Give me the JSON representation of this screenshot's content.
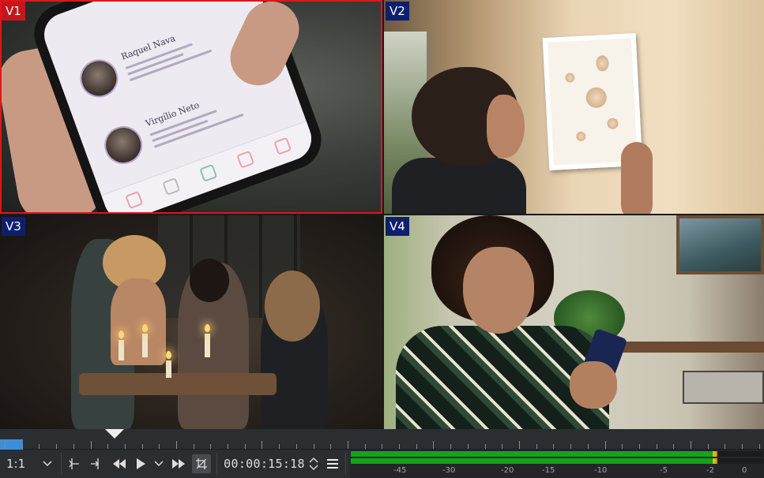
{
  "multicam": {
    "active_view": "V1",
    "views": [
      {
        "id": "v1",
        "label": "V1",
        "content": "Hand holding a phone showing profile app"
      },
      {
        "id": "v2",
        "label": "V2",
        "content": "Man hanging a shell frame on a wall"
      },
      {
        "id": "v3",
        "label": "V3",
        "content": "Candlelit dinner party"
      },
      {
        "id": "v4",
        "label": "V4",
        "content": "Woman looking at her phone"
      }
    ],
    "phone_screen": {
      "person1_name": "Raquel Nava",
      "person2_name": "Virgílio Neto"
    }
  },
  "timeline": {
    "progress_fraction": 0.03
  },
  "toolbar": {
    "zoom_label": "1:1",
    "timecode": "00:00:15:18",
    "icons": [
      "zoom-dropdown-icon",
      "set-zone-in-icon",
      "set-zone-out-icon",
      "rewind-icon",
      "play-icon",
      "play-options-icon",
      "forward-icon",
      "crop-icon",
      "spin-icon",
      "menu-icon"
    ]
  },
  "audio_meter": {
    "scale": [
      "-45",
      "-30",
      "-20",
      "-15",
      "-10",
      "-5",
      "-2",
      "0"
    ],
    "level_left_db": -2,
    "level_right_db": -2,
    "colors": {
      "green": "#14a31d",
      "yellow": "#c8c21a",
      "orange": "#d28a10"
    }
  },
  "colors": {
    "active_border": "#e0151b",
    "active_badge": "#c4161c",
    "inactive_badge": "#0d1f6e",
    "progress": "#3d8ed9"
  }
}
